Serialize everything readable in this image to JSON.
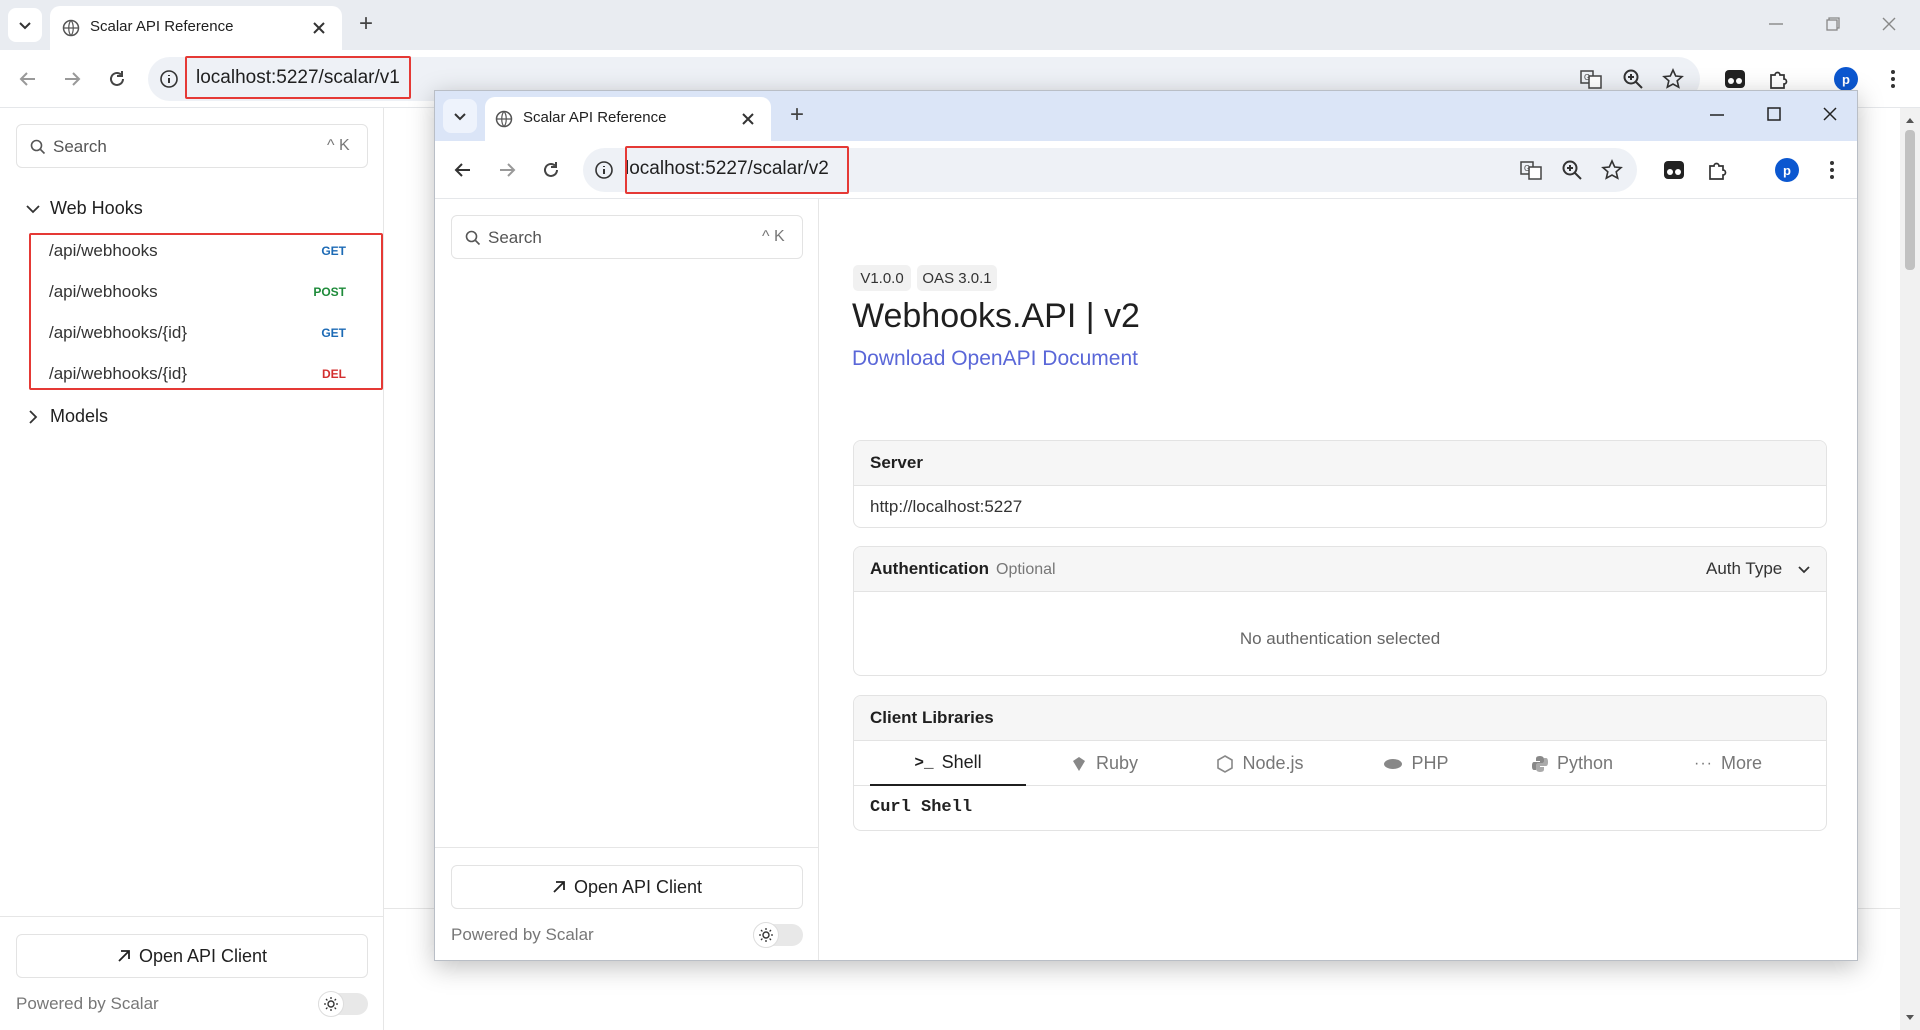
{
  "back_window": {
    "tab_title": "Scalar API Reference",
    "new_tab_glyph": "+",
    "url": "localhost:5227/scalar/v1",
    "avatar_letter": "p",
    "sidebar": {
      "search_placeholder": "Search",
      "search_shortcut": "^ K",
      "groups": [
        {
          "label": "Web Hooks",
          "expanded": true
        },
        {
          "label": "Models",
          "expanded": false
        }
      ],
      "endpoints": [
        {
          "path": "/api/webhooks",
          "method": "GET"
        },
        {
          "path": "/api/webhooks",
          "method": "POST"
        },
        {
          "path": "/api/webhooks/{id}",
          "method": "GET"
        },
        {
          "path": "/api/webhooks/{id}",
          "method": "DEL"
        }
      ],
      "open_client_label": "Open API Client",
      "powered_by": "Powered by Scalar"
    }
  },
  "front_window": {
    "tab_title": "Scalar API Reference",
    "new_tab_glyph": "+",
    "url": "localhost:5227/scalar/v2",
    "avatar_letter": "p",
    "sidebar": {
      "search_placeholder": "Search",
      "search_shortcut": "^ K",
      "open_client_label": "Open API Client",
      "powered_by": "Powered by Scalar"
    },
    "main": {
      "version_badge": "V1.0.0",
      "oas_badge": "OAS 3.0.1",
      "title": "Webhooks.API | v2",
      "download_link": "Download OpenAPI Document",
      "server": {
        "title": "Server",
        "url": "http://localhost:5227"
      },
      "auth": {
        "title": "Authentication",
        "optional": "Optional",
        "auth_type": "Auth Type",
        "empty": "No authentication selected"
      },
      "client_libraries": {
        "title": "Client Libraries",
        "tabs": [
          "Shell",
          "Ruby",
          "Node.js",
          "PHP",
          "Python",
          "More"
        ],
        "active_tab": "Shell",
        "code_label": "Curl Shell"
      }
    }
  },
  "colors": {
    "accent_link": "#5a67d8",
    "highlight_box": "#e53935",
    "get": "#1c6ab5",
    "post": "#1e8b3a",
    "del": "#d32f2f"
  }
}
